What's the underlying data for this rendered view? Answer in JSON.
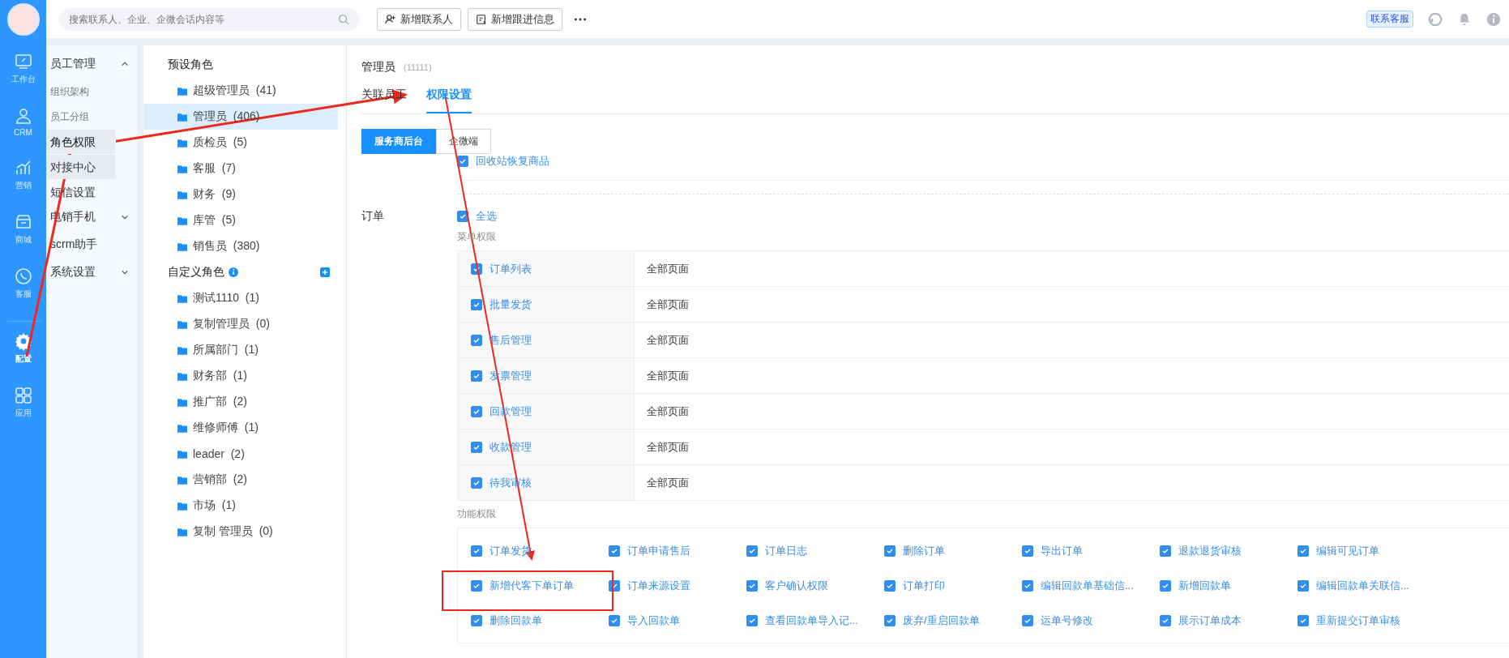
{
  "nav_rail": [
    {
      "label": "工作台",
      "kind": "desk",
      "selected": false
    },
    {
      "label": "CRM",
      "kind": "person",
      "selected": false
    },
    {
      "label": "营销",
      "kind": "chart",
      "selected": false
    },
    {
      "label": "商城",
      "kind": "shop",
      "selected": false
    },
    {
      "label": "客服",
      "kind": "chat",
      "selected": false
    },
    {
      "label": "配置",
      "kind": "gear",
      "selected": true
    },
    {
      "label": "应用",
      "kind": "apps",
      "selected": false
    }
  ],
  "top_bar": {
    "search": {
      "placeholder": "搜索联系人、企业、企微会话内容等"
    },
    "buttons": [
      {
        "label": "新增联系人",
        "kind": "person"
      },
      {
        "label": "新增跟进信息",
        "kind": "note"
      }
    ],
    "support_badge": "联系客服"
  },
  "sidebar": {
    "items": [
      {
        "label": "员工管理",
        "expanded": true,
        "children": [
          {
            "label": "组织架构",
            "muted": true,
            "selected": false,
            "hovered": false
          },
          {
            "label": "员工分组",
            "muted": true,
            "selected": false,
            "hovered": false
          },
          {
            "label": "角色权限",
            "muted": false,
            "selected": true,
            "hovered": false
          },
          {
            "label": "对接中心",
            "muted": false,
            "selected": false,
            "hovered": true
          },
          {
            "label": "短信设置",
            "muted": false,
            "selected": false,
            "hovered": false
          }
        ]
      },
      {
        "label": "电销手机",
        "expanded": false
      },
      {
        "label": "scrm助手"
      },
      {
        "label": "系统设置",
        "expanded": false
      }
    ]
  },
  "roles": {
    "preset_title": "预设角色",
    "preset": [
      {
        "name": "超级管理员",
        "count": "(41)",
        "selected": false
      },
      {
        "name": "管理员",
        "count": "(406)",
        "selected": true
      },
      {
        "name": "质检员",
        "count": "(5)",
        "selected": false
      },
      {
        "name": "客服",
        "count": "(7)",
        "selected": false
      },
      {
        "name": "财务",
        "count": "(9)",
        "selected": false
      },
      {
        "name": "库管",
        "count": "(5)",
        "selected": false
      },
      {
        "name": "销售员",
        "count": "(380)",
        "selected": false
      }
    ],
    "custom_title": "自定义角色",
    "custom": [
      {
        "name": "测试1110",
        "count": "(1)",
        "selected": false
      },
      {
        "name": "复制管理员",
        "count": "(0)",
        "selected": false
      },
      {
        "name": "所属部门",
        "count": "(1)",
        "selected": false
      },
      {
        "name": "财务部",
        "count": "(1)",
        "selected": false
      },
      {
        "name": "推广部",
        "count": "(2)",
        "selected": false
      },
      {
        "name": "维修师傅",
        "count": "(1)",
        "selected": false
      },
      {
        "name": "leader",
        "count": "(2)",
        "selected": false
      },
      {
        "name": "营销部",
        "count": "(2)",
        "selected": false
      },
      {
        "name": "市场",
        "count": "(1)",
        "selected": false
      },
      {
        "name": "复制 管理员",
        "count": "(0)",
        "selected": false
      }
    ]
  },
  "detail": {
    "title": "管理员",
    "code": "(11111)",
    "tabs": [
      {
        "label": "关联员工",
        "selected": false
      },
      {
        "label": "权限设置",
        "selected": true
      }
    ],
    "segments": [
      {
        "label": "服务商后台",
        "selected": true
      },
      {
        "label": "企微端",
        "selected": false
      }
    ],
    "previous_items": [
      {
        "label": "回收站恢复商品",
        "checked": true
      }
    ],
    "section": {
      "title": "订单",
      "select_all": {
        "label": "全选",
        "checked": true
      },
      "menu_label": "菜单权限",
      "menu_rows": [
        {
          "name": "订单列表",
          "checked": true,
          "scope": "全部页面"
        },
        {
          "name": "批量发货",
          "checked": true,
          "scope": "全部页面"
        },
        {
          "name": "售后管理",
          "checked": true,
          "scope": "全部页面"
        },
        {
          "name": "发票管理",
          "checked": true,
          "scope": "全部页面"
        },
        {
          "name": "回款管理",
          "checked": true,
          "scope": "全部页面"
        },
        {
          "name": "收款管理",
          "checked": true,
          "scope": "全部页面"
        },
        {
          "name": "待我审核",
          "checked": true,
          "scope": "全部页面"
        }
      ],
      "function_label": "功能权限",
      "functions": [
        {
          "label": "订单发货",
          "checked": true
        },
        {
          "label": "订单申请售后",
          "checked": true
        },
        {
          "label": "订单日志",
          "checked": true
        },
        {
          "label": "删除订单",
          "checked": true
        },
        {
          "label": "导出订单",
          "checked": true
        },
        {
          "label": "退款退货审核",
          "checked": true
        },
        {
          "label": "编辑可见订单",
          "checked": true
        },
        {
          "label": "新增代客下单订单",
          "checked": true
        },
        {
          "label": "订单来源设置",
          "checked": true
        },
        {
          "label": "客户确认权限",
          "checked": true
        },
        {
          "label": "订单打印",
          "checked": true
        },
        {
          "label": "编辑回款单基础信...",
          "checked": true
        },
        {
          "label": "新增回款单",
          "checked": true
        },
        {
          "label": "编辑回款单关联信...",
          "checked": true
        },
        {
          "label": "删除回款单",
          "checked": true
        },
        {
          "label": "导入回款单",
          "checked": true
        },
        {
          "label": "查看回款单导入记...",
          "checked": true
        },
        {
          "label": "废弃/重启回款单",
          "checked": true
        },
        {
          "label": "运单号修改",
          "checked": true
        },
        {
          "label": "展示订单成本",
          "checked": true
        },
        {
          "label": "重新提交订单审核",
          "checked": true
        }
      ]
    }
  }
}
